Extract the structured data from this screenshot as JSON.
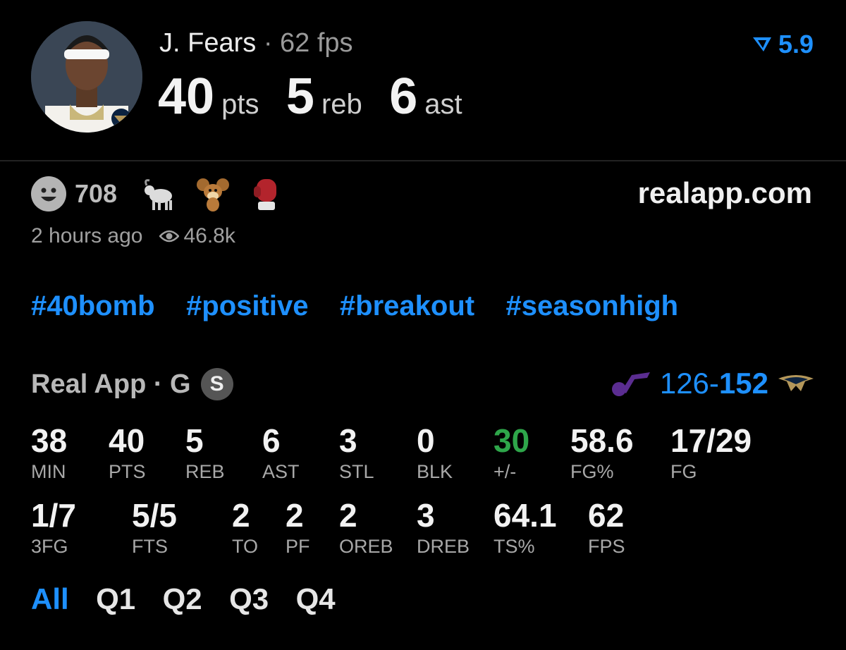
{
  "player": {
    "name": "J. Fears",
    "separator": "·",
    "fps_text": "62 fps",
    "pts": "40",
    "pts_unit": "pts",
    "reb": "5",
    "reb_unit": "reb",
    "ast": "6",
    "ast_unit": "ast",
    "rating": "5.9"
  },
  "social": {
    "reaction_count": "708",
    "emojis": [
      "goat",
      "cartoon-mouse",
      "boxing-glove"
    ],
    "site": "realapp.com",
    "time_ago": "2 hours ago",
    "views": "46.8k"
  },
  "tags": [
    "#40bomb",
    "#positive",
    "#breakout",
    "#seasonhigh"
  ],
  "game": {
    "source": "Real App · G",
    "badge": "S",
    "away_score": "126",
    "dash": "-",
    "home_score": "152"
  },
  "stats_row1": [
    {
      "value": "38",
      "label": "MIN"
    },
    {
      "value": "40",
      "label": "PTS"
    },
    {
      "value": "5",
      "label": "REB"
    },
    {
      "value": "6",
      "label": "AST"
    },
    {
      "value": "3",
      "label": "STL"
    },
    {
      "value": "0",
      "label": "BLK"
    },
    {
      "value": "30",
      "label": "+/-"
    },
    {
      "value": "58.6",
      "label": "FG%"
    },
    {
      "value": "17/29",
      "label": "FG"
    }
  ],
  "stats_row2": [
    {
      "value": "1/7",
      "label": "3FG"
    },
    {
      "value": "5/5",
      "label": "FTS"
    },
    {
      "value": "2",
      "label": "TO"
    },
    {
      "value": "2",
      "label": "PF"
    },
    {
      "value": "2",
      "label": "OREB"
    },
    {
      "value": "3",
      "label": "DREB"
    },
    {
      "value": "64.1",
      "label": "TS%"
    },
    {
      "value": "62",
      "label": "FPS"
    }
  ],
  "quarters": [
    "All",
    "Q1",
    "Q2",
    "Q3",
    "Q4"
  ],
  "colors": {
    "accent": "#1e90ff",
    "positive": "#2ea64a",
    "away_team": "#5b2d91"
  }
}
